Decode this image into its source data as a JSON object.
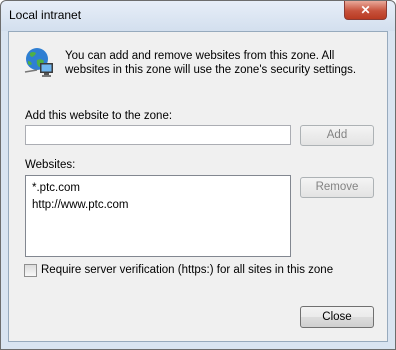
{
  "window": {
    "title": "Local intranet",
    "close_glyph": "✕"
  },
  "intro_text": "You can add and remove websites from this zone. All websites in this zone will use the zone's security settings.",
  "icon_name": "local-intranet-globe-icon",
  "add": {
    "label": "Add this website to the zone:",
    "input_value": "",
    "button_label": "Add"
  },
  "websites": {
    "label": "Websites:",
    "items": [
      "*.ptc.com",
      "http://www.ptc.com"
    ],
    "remove_label": "Remove"
  },
  "https_check": {
    "label": "Require server verification (https:) for all sites in this zone",
    "checked": false
  },
  "close_label": "Close",
  "colors": {
    "window_frame": "#d9e4f1",
    "client_bg": "#f0f0f0",
    "close_red": "#c7523c"
  }
}
